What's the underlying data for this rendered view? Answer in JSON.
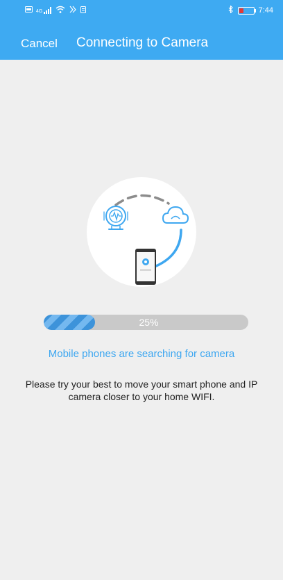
{
  "status_bar": {
    "time": "7:44",
    "signal_label": "4G",
    "battery_color": "#e53935"
  },
  "header": {
    "cancel_label": "Cancel",
    "title": "Connecting to Camera",
    "background_color": "#3eaaf2"
  },
  "illustration": {
    "icons": [
      "camera-icon",
      "cloud-icon",
      "phone-icon"
    ]
  },
  "progress": {
    "value": 0.25,
    "label": "25%"
  },
  "status_message": "Mobile phones are searching for camera",
  "hint": "Please try your best to move your smart phone and IP camera closer to your home WIFI."
}
